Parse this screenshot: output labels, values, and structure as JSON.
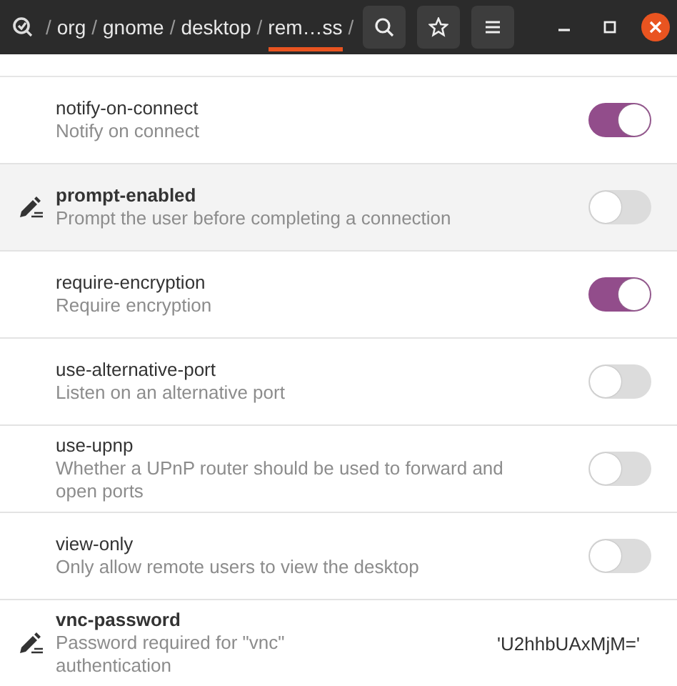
{
  "path": [
    {
      "kind": "separator",
      "label": "/"
    },
    {
      "kind": "segment",
      "label": "org",
      "selected": false
    },
    {
      "kind": "separator",
      "label": "/"
    },
    {
      "kind": "segment",
      "label": "gnome",
      "selected": false
    },
    {
      "kind": "separator",
      "label": "/"
    },
    {
      "kind": "segment",
      "label": "desktop",
      "selected": false
    },
    {
      "kind": "separator",
      "label": "/"
    },
    {
      "kind": "segment",
      "label": "rem…ss",
      "selected": true
    },
    {
      "kind": "separator",
      "label": "/"
    }
  ],
  "keys": [
    {
      "name": "notify-on-connect",
      "description": "Notify on connect",
      "modified": false,
      "selected": false,
      "kind": "toggle",
      "on": true
    },
    {
      "name": "prompt-enabled",
      "description": "Prompt the user before completing a connection",
      "modified": true,
      "selected": true,
      "kind": "toggle",
      "on": false
    },
    {
      "name": "require-encryption",
      "description": "Require encryption",
      "modified": false,
      "selected": false,
      "kind": "toggle",
      "on": true
    },
    {
      "name": "use-alternative-port",
      "description": "Listen on an alternative port",
      "modified": false,
      "selected": false,
      "kind": "toggle",
      "on": false
    },
    {
      "name": "use-upnp",
      "description": "Whether a UPnP router should be used to forward and open ports",
      "modified": false,
      "selected": false,
      "kind": "toggle",
      "on": false
    },
    {
      "name": "view-only",
      "description": "Only allow remote users to view the desktop",
      "modified": false,
      "selected": false,
      "kind": "toggle",
      "on": false
    },
    {
      "name": "vnc-password",
      "description": "Password required for \"vnc\" authentication",
      "modified": true,
      "selected": false,
      "kind": "value",
      "value": "'U2hhbUAxMjM='"
    }
  ]
}
